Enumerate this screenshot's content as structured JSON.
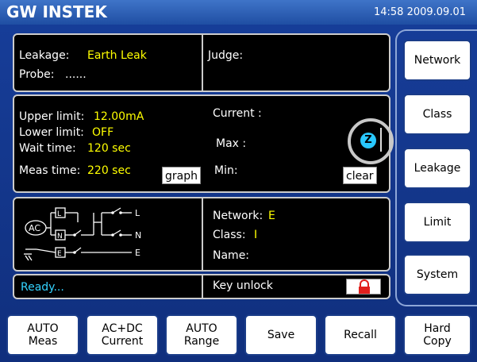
{
  "header": {
    "logo": "GW INSTEK",
    "datetime": "14:58  2009.09.01"
  },
  "mode_panel": {
    "leakage_label": "Leakage:",
    "leakage_value": "Earth Leak",
    "probe_label": "Probe:",
    "probe_value": "......",
    "judge_label": "Judge:"
  },
  "settings_panel": {
    "upper_label": "Upper limit:",
    "upper_value": "12.00mA",
    "lower_label": "Lower limit:",
    "lower_value": "OFF",
    "wait_label": "Wait time:",
    "wait_value": "120 sec",
    "meas_label": "Meas time:",
    "meas_value": "220 sec",
    "graph_button": "graph",
    "current_label": "Current :",
    "max_label": "Max :",
    "min_label": "Min:",
    "clear_button": "clear",
    "zero_badge": "Z"
  },
  "circuit_panel": {
    "ac_label": "AC",
    "l_box": "L",
    "n_box": "N",
    "e_box": "E",
    "l_out": "L",
    "n_out": "N",
    "e_out": "E",
    "network_label": "Network:",
    "network_value": "E",
    "class_label": "Class:",
    "class_value": "I",
    "name_label": "Name:"
  },
  "status": {
    "ready": "Ready...",
    "key_unlock": "Key unlock"
  },
  "side_menu": [
    "Network",
    "Class",
    "Leakage",
    "Limit",
    "System"
  ],
  "bottom_menu": [
    {
      "line1": "AUTO",
      "line2": "Meas"
    },
    {
      "line1": "AC+DC",
      "line2": "Current"
    },
    {
      "line1": "AUTO",
      "line2": "Range"
    },
    {
      "line1": "Save",
      "line2": ""
    },
    {
      "line1": "Recall",
      "line2": ""
    },
    {
      "line1": "Hard",
      "line2": "Copy"
    }
  ],
  "colors": {
    "accent_yellow": "#ffff00",
    "status_cyan": "#34d3ff",
    "lock_red": "#e0201c",
    "background_blue": "#173e9a"
  },
  "icons": {
    "lock": "lock-icon",
    "zero": "zero-icon"
  }
}
